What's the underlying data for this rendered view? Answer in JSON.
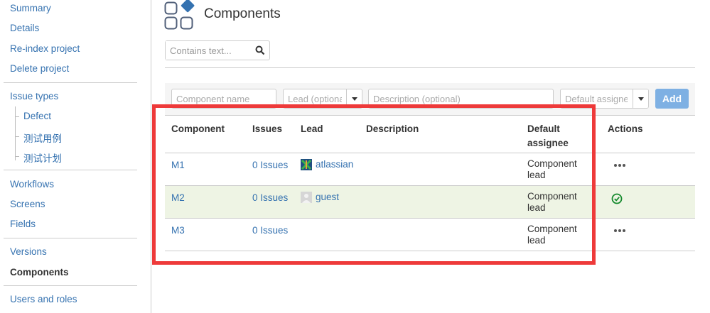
{
  "sidebar": {
    "items": [
      {
        "label": "Summary"
      },
      {
        "label": "Details"
      },
      {
        "label": "Re-index project"
      },
      {
        "label": "Delete project"
      },
      {
        "label": "Issue types"
      },
      {
        "label": "Defect"
      },
      {
        "label": "测试用例"
      },
      {
        "label": "测试计划"
      },
      {
        "label": "Workflows"
      },
      {
        "label": "Screens"
      },
      {
        "label": "Fields"
      },
      {
        "label": "Versions"
      },
      {
        "label": "Components"
      },
      {
        "label": "Users and roles"
      }
    ],
    "active": "Components"
  },
  "header": {
    "title": "Components",
    "search_placeholder": "Contains text..."
  },
  "add_form": {
    "name_placeholder": "Component name",
    "lead_placeholder": "Lead (optional)",
    "description_placeholder": "Description (optional)",
    "assignee_placeholder": "Default assignee",
    "add_label": "Add"
  },
  "table": {
    "columns": [
      "Component",
      "Issues",
      "Lead",
      "Description",
      "Default assignee",
      "Actions"
    ],
    "rows": [
      {
        "name": "M1",
        "issues": "0 Issues",
        "lead": "atlassian",
        "description": "",
        "assignee": "Component lead",
        "action": "more-icon"
      },
      {
        "name": "M2",
        "issues": "0 Issues",
        "lead": "guest",
        "description": "",
        "assignee": "Component lead",
        "action": "check-icon"
      },
      {
        "name": "M3",
        "issues": "0 Issues",
        "lead": "",
        "description": "",
        "assignee": "Component lead",
        "action": "more-icon"
      }
    ]
  },
  "colors": {
    "link": "#3572b0",
    "highlight_row": "#eef4e4",
    "add_button": "#7eb0e3",
    "annotation": "#ee3a3a",
    "success": "#14892c"
  }
}
